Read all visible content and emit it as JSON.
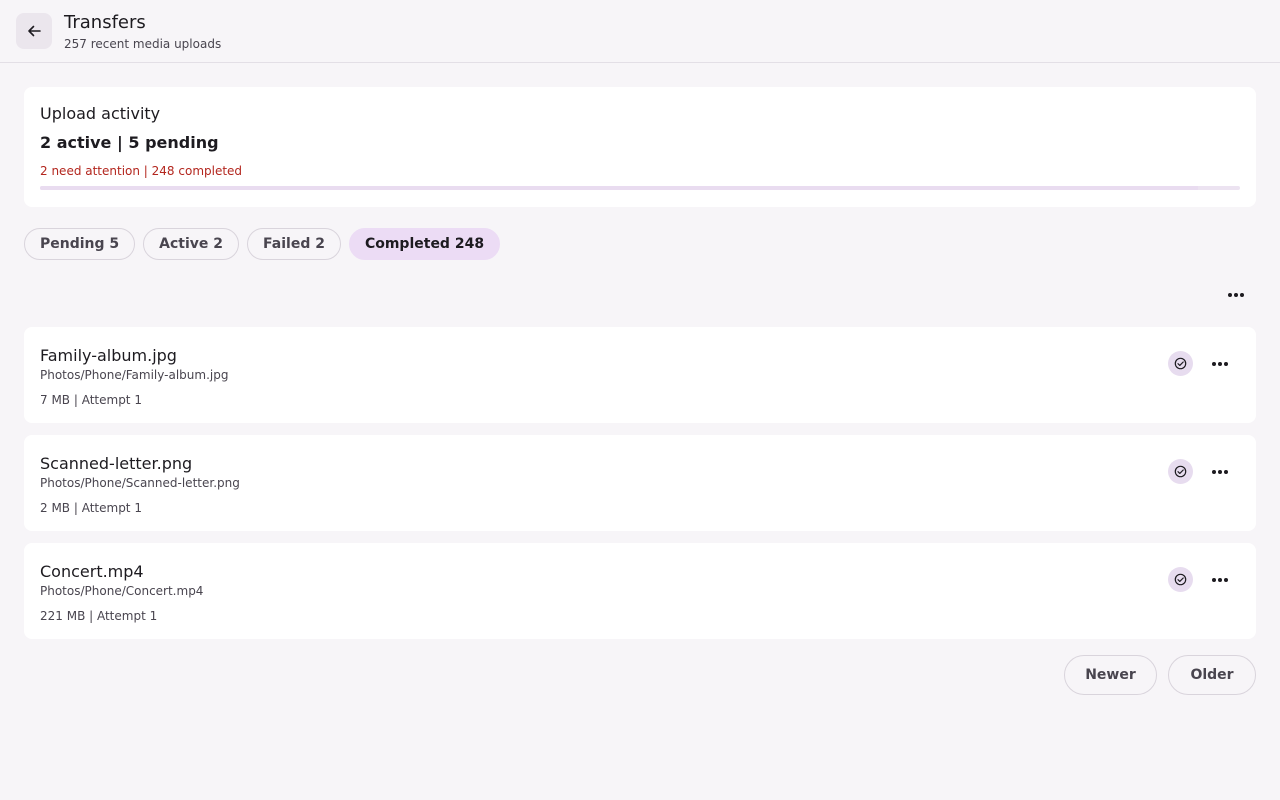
{
  "header": {
    "title": "Transfers",
    "subtitle": "257 recent media uploads",
    "back_icon": "arrow-left-icon"
  },
  "summary": {
    "heading": "Upload activity",
    "counts": "2 active | 5 pending",
    "alert": "2 need attention | 248 completed",
    "progress_fraction": 0.965,
    "alert_color": "#b3261e"
  },
  "filters": [
    {
      "label": "Pending 5",
      "selected": false
    },
    {
      "label": "Active 2",
      "selected": false
    },
    {
      "label": "Failed 2",
      "selected": false
    },
    {
      "label": "Completed 248",
      "selected": true
    }
  ],
  "transfers": [
    {
      "name": "Family-album.jpg",
      "path": "Photos/Phone/Family-album.jpg",
      "meta": "7 MB | Attempt 1",
      "status_icon": "check-circle-icon"
    },
    {
      "name": "Scanned-letter.png",
      "path": "Photos/Phone/Scanned-letter.png",
      "meta": "2 MB | Attempt 1",
      "status_icon": "check-circle-icon"
    },
    {
      "name": "Concert.mp4",
      "path": "Photos/Phone/Concert.mp4",
      "meta": "221 MB | Attempt 1",
      "status_icon": "check-circle-icon"
    }
  ],
  "pager": {
    "newer_label": "Newer",
    "older_label": "Older"
  },
  "colors": {
    "accent_chip": "#ecdcf5",
    "status_bg": "#e7dcef"
  }
}
